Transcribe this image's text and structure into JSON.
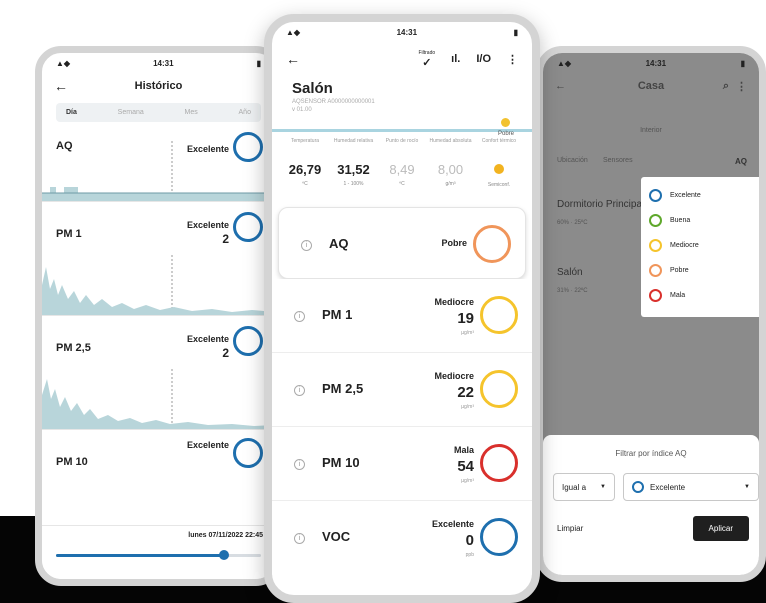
{
  "left_phone": {
    "time": "14:31",
    "title": "Histórico",
    "tabs": [
      "Día",
      "Semana",
      "Mes",
      "Año"
    ],
    "rows": [
      {
        "label": "AQ",
        "quality": "Excelente",
        "value": ""
      },
      {
        "label": "PM 1",
        "quality": "Excelente",
        "value": "2"
      },
      {
        "label": "PM 2,5",
        "quality": "Excelente",
        "value": "2"
      },
      {
        "label": "PM 10",
        "quality": "Excelente",
        "value": ""
      }
    ],
    "slider_date": "lunes 07/11/2022 22:45",
    "slider_position": 0.82
  },
  "middle_phone": {
    "time": "14:31",
    "menu_label": "Filtrado",
    "io_label": "I/O",
    "device_name": "Salón",
    "device_id": "AQSENSOR A0000000000001",
    "firmware": "v 01.00",
    "badge": "Pobre",
    "measurements": [
      {
        "header": "Temperatura",
        "value": "26,79",
        "unit": "ºC",
        "dim": false
      },
      {
        "header": "Humedad relativa",
        "value": "31,52",
        "unit": "1 - 100%",
        "dim": false
      },
      {
        "header": "Punto de rocío",
        "value": "8,49",
        "unit": "ºC",
        "dim": true
      },
      {
        "header": "Humedad absoluta",
        "value": "8,00",
        "unit": "g/m³",
        "dim": true
      },
      {
        "header": "Confort térmico",
        "value": "",
        "unit": "Semiconf.",
        "dim": false
      }
    ],
    "sensors": [
      {
        "name": "AQ",
        "quality": "Pobre",
        "value": "",
        "unit": "",
        "color": "#f0955a"
      },
      {
        "name": "PM 1",
        "quality": "Mediocre",
        "value": "19",
        "unit": "µg/m³",
        "color": "#f5c42c"
      },
      {
        "name": "PM 2,5",
        "quality": "Mediocre",
        "value": "22",
        "unit": "µg/m³",
        "color": "#f5c42c"
      },
      {
        "name": "PM 10",
        "quality": "Mala",
        "value": "54",
        "unit": "µg/m³",
        "color": "#d9302c"
      },
      {
        "name": "VOC",
        "quality": "Excelente",
        "value": "0",
        "unit": "ppb",
        "color": "#1e6fae"
      }
    ]
  },
  "right_phone": {
    "time": "14:31",
    "title": "Casa",
    "subheader": "Interior",
    "col_left": "Ubicación",
    "col_mid": "Sensores",
    "col_right": "AQ",
    "items": [
      {
        "name": "Dormitorio Principal",
        "detail": "60% · 25ºC"
      },
      {
        "name": "Salón",
        "detail": "31% · 22ºC"
      }
    ],
    "legend": [
      {
        "label": "Excelente",
        "color": "#1e6fae"
      },
      {
        "label": "Buena",
        "color": "#5fa82c"
      },
      {
        "label": "Mediocre",
        "color": "#f5c42c"
      },
      {
        "label": "Pobre",
        "color": "#f0955a"
      },
      {
        "label": "Mala",
        "color": "#d9302c"
      }
    ],
    "sheet_title": "Filtrar por índice AQ",
    "operator": "Igual a",
    "filter_value": "Excelente",
    "clear_label": "Limpiar",
    "apply_label": "Aplicar"
  },
  "colors": {
    "accent": "#1e6fae",
    "chart_fill": "#b8d5da"
  }
}
